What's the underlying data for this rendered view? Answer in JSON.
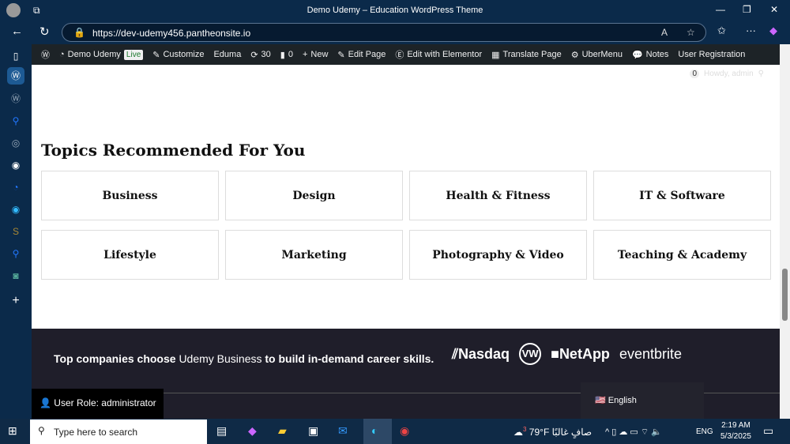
{
  "browser": {
    "title": "Demo Udemy – Education WordPress Theme",
    "url": "https://dev-udemy456.pantheonsite.io"
  },
  "adminbar": {
    "site": "Demo Udemy",
    "live": "Live",
    "items": [
      "Customize",
      "Eduma",
      "30",
      "0",
      "New",
      "Edit Page",
      "Edit with Elementor",
      "Translate Page",
      "UberMenu",
      "Notes",
      "User Registration"
    ]
  },
  "header": {
    "cart_count": "0",
    "howdy": "Howdy, admin"
  },
  "main": {
    "heading": "Topics Recommended For You",
    "topics": [
      "Business",
      "Design",
      "Health & Fitness",
      "IT & Software",
      "Lifestyle",
      "Marketing",
      "Photography & Video",
      "Teaching & Academy"
    ]
  },
  "footer": {
    "tag_pre": "Top companies choose",
    "tag_hl": "Udemy Business",
    "tag_post": "to build in-demand career skills.",
    "logos": [
      "Nasdaq",
      "VW",
      "NetApp",
      "eventbrite"
    ]
  },
  "role": "User Role: administrator",
  "language": "English",
  "taskbar": {
    "search_placeholder": "Type here to search",
    "weather": "79°F",
    "weather_desc": "صافٍ غالبًا",
    "weather_badge": "3",
    "lang": "ENG",
    "time": "2:19 AM",
    "date": "5/3/2025"
  }
}
